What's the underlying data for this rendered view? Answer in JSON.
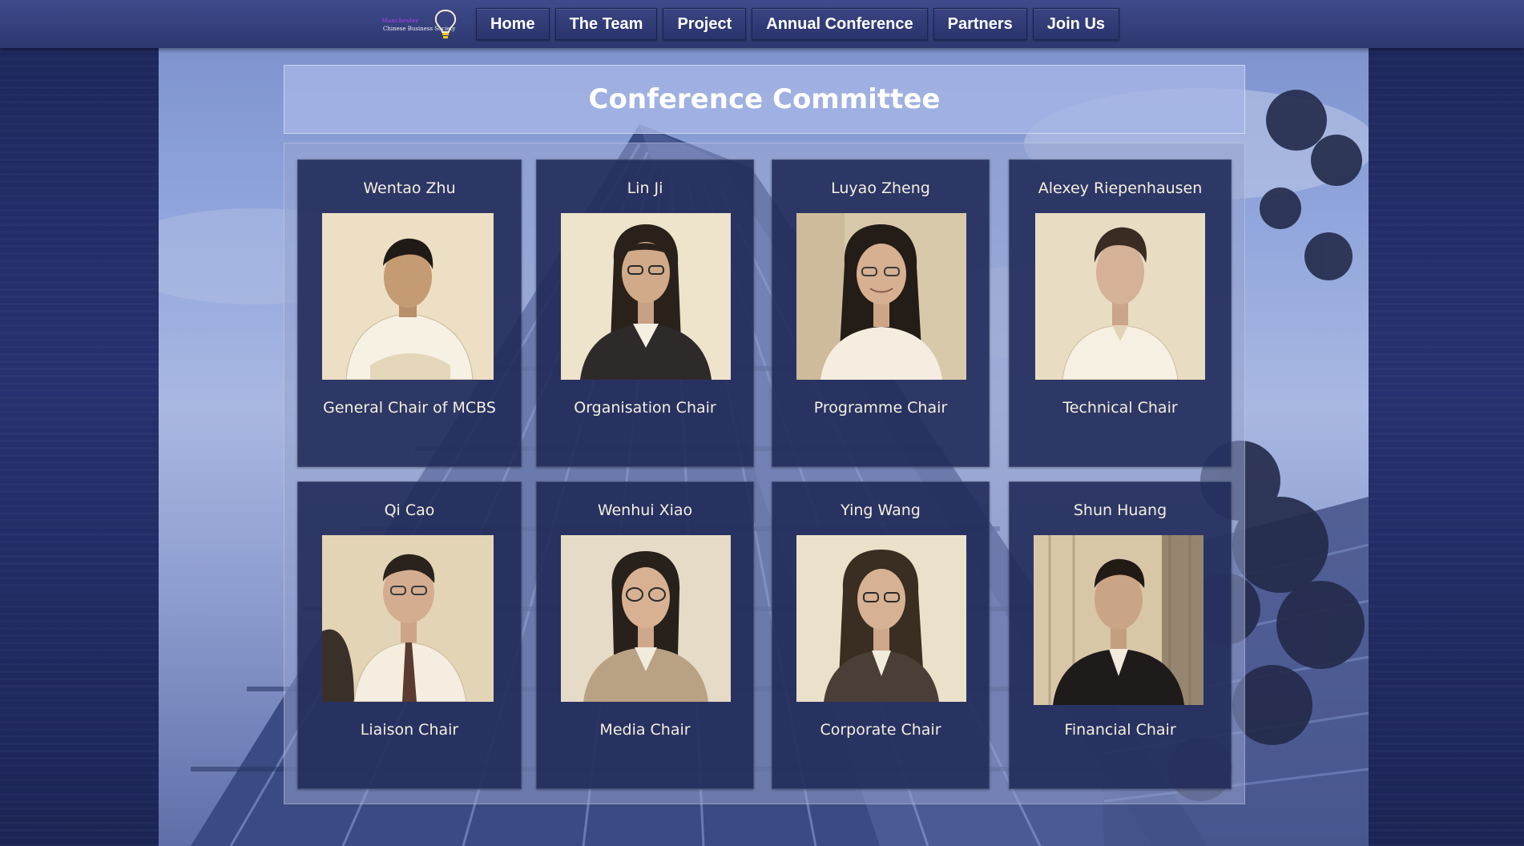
{
  "nav": {
    "logo": {
      "title": "Manchester",
      "subtitle": "Chinese Business Society"
    },
    "items": [
      {
        "label": "Home"
      },
      {
        "label": "The Team"
      },
      {
        "label": "Project"
      },
      {
        "label": "Annual Conference"
      },
      {
        "label": "Partners"
      },
      {
        "label": "Join Us"
      }
    ]
  },
  "page": {
    "title": "Conference Committee"
  },
  "members": [
    {
      "name": "Wentao Zhu",
      "role": "General Chair of MCBS",
      "photo": "portrait-man-arms-crossed"
    },
    {
      "name": "Lin Ji",
      "role": "Organisation Chair",
      "photo": "portrait-woman-glasses"
    },
    {
      "name": "Luyao Zheng",
      "role": "Programme Chair",
      "photo": "portrait-woman-smiling"
    },
    {
      "name": "Alexey Riepenhausen",
      "role": "Technical Chair",
      "photo": "portrait-man"
    },
    {
      "name": "Qi Cao",
      "role": "Liaison Chair",
      "photo": "portrait-man-glasses-tie"
    },
    {
      "name": "Wenhui Xiao",
      "role": "Media Chair",
      "photo": "portrait-woman-glasses"
    },
    {
      "name": "Ying Wang",
      "role": "Corporate Chair",
      "photo": "portrait-woman-glasses-long-hair"
    },
    {
      "name": "Shun Huang",
      "role": "Financial Chair",
      "photo": "portrait-man-suit"
    }
  ],
  "colors": {
    "nav_bg": "#2d386f",
    "card_bg": "#1f2856",
    "photo_sepia": "#eadcc0",
    "logo_purple": "#8a3fd1"
  }
}
